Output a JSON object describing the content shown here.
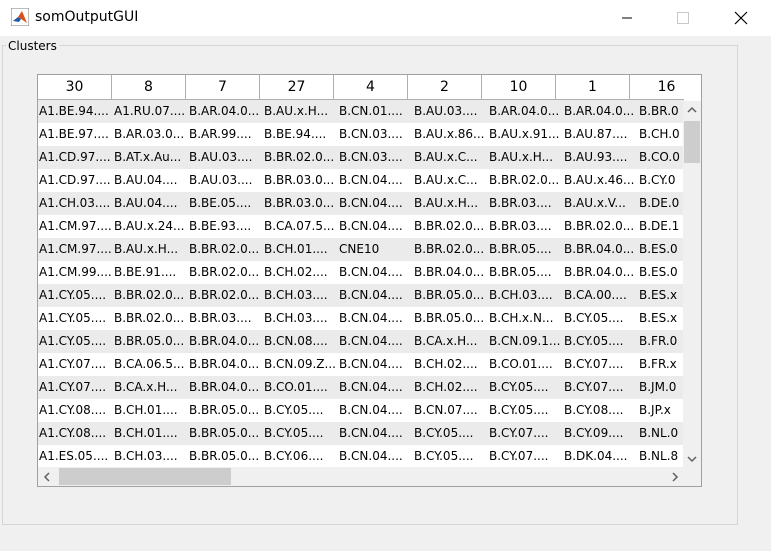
{
  "window": {
    "title": "somOutputGUI"
  },
  "panel": {
    "title": "Clusters"
  },
  "table": {
    "columns": [
      "30",
      "8",
      "7",
      "27",
      "4",
      "2",
      "10",
      "1",
      "16"
    ],
    "rows": [
      [
        "A1.BE.94....",
        "A1.RU.07....",
        "B.AR.04.0...",
        "B.AU.x.H...",
        "B.CN.01....",
        "B.AU.03....",
        "B.AR.04.0...",
        "B.AR.04.0...",
        "B.BR.0"
      ],
      [
        "A1.BE.97....",
        "B.AR.03.0...",
        "B.AR.99....",
        "B.BE.94....",
        "B.CN.03....",
        "B.AU.x.86...",
        "B.AU.x.91...",
        "B.AU.87....",
        "B.CH.0"
      ],
      [
        "A1.CD.97....",
        "B.AT.x.Au...",
        "B.AU.03....",
        "B.BR.02.0...",
        "B.CN.03....",
        "B.AU.x.C...",
        "B.AU.x.H...",
        "B.AU.93....",
        "B.CO.0"
      ],
      [
        "A1.CD.97....",
        "B.AU.04....",
        "B.AU.03....",
        "B.BR.03.0...",
        "B.CN.04....",
        "B.AU.x.C...",
        "B.BR.02.0...",
        "B.AU.x.46...",
        "B.CY.0"
      ],
      [
        "A1.CH.03....",
        "B.AU.04....",
        "B.BE.05....",
        "B.BR.03.0...",
        "B.CN.04....",
        "B.AU.x.H...",
        "B.BR.03....",
        "B.AU.x.V...",
        "B.DE.0"
      ],
      [
        "A1.CM.97....",
        "B.AU.x.24...",
        "B.BE.93....",
        "B.CA.07.5...",
        "B.CN.04....",
        "B.BR.02.0...",
        "B.BR.03....",
        "B.BR.02.0...",
        "B.DE.1"
      ],
      [
        "A1.CM.97....",
        "B.AU.x.H...",
        "B.BR.02.0...",
        "B.CH.01....",
        "CNE10",
        "B.BR.02.0...",
        "B.BR.05....",
        "B.BR.04.0...",
        "B.ES.0"
      ],
      [
        "A1.CM.99....",
        "B.BE.91....",
        "B.BR.02.0...",
        "B.CH.02....",
        "B.CN.04....",
        "B.BR.04.0...",
        "B.BR.05....",
        "B.BR.04.0...",
        "B.ES.0"
      ],
      [
        "A1.CY.05....",
        "B.BR.02.0...",
        "B.BR.02.0...",
        "B.CH.03....",
        "B.CN.04....",
        "B.BR.05.0...",
        "B.CH.03....",
        "B.CA.00....",
        "B.ES.x"
      ],
      [
        "A1.CY.05....",
        "B.BR.02.0...",
        "B.BR.03....",
        "B.CH.03....",
        "B.CN.04....",
        "B.BR.05.0...",
        "B.CH.x.N...",
        "B.CY.05....",
        "B.ES.x"
      ],
      [
        "A1.CY.05....",
        "B.BR.05.0...",
        "B.BR.04.0...",
        "B.CN.08....",
        "B.CN.04....",
        "B.CA.x.H...",
        "B.CN.09.1...",
        "B.CY.05....",
        "B.FR.0"
      ],
      [
        "A1.CY.07....",
        "B.CA.06.5...",
        "B.BR.04.0...",
        "B.CN.09.Z...",
        "B.CN.04....",
        "B.CH.02....",
        "B.CO.01....",
        "B.CY.07....",
        "B.FR.x"
      ],
      [
        "A1.CY.07....",
        "B.CA.x.H...",
        "B.BR.04.0...",
        "B.CO.01....",
        "B.CN.04....",
        "B.CH.02....",
        "B.CY.05....",
        "B.CY.07....",
        "B.JM.0"
      ],
      [
        "A1.CY.08....",
        "B.CH.01....",
        "B.BR.05.0...",
        "B.CY.05....",
        "B.CN.04....",
        "B.CN.07....",
        "B.CY.05....",
        "B.CY.08....",
        "B.JP.x"
      ],
      [
        "A1.CY.08....",
        "B.CH.01....",
        "B.BR.05.0...",
        "B.CY.05....",
        "B.CN.04....",
        "B.CY.05....",
        "B.CY.07....",
        "B.CY.09....",
        "B.NL.0"
      ],
      [
        "A1.ES.05....",
        "B.CH.03....",
        "B.BR.05.0...",
        "B.CY.06....",
        "B.CN.04....",
        "B.CY.05....",
        "B.CY.07....",
        "B.DK.04....",
        "B.NL.8"
      ]
    ]
  },
  "icons": {
    "app": "matlab-icon",
    "minimize": "minimize-icon",
    "maximize": "maximize-icon",
    "close": "close-icon"
  },
  "colors": {
    "row_alt": "#ebebeb",
    "row_white": "#ffffff",
    "client_bg": "#f0f0f0",
    "scroll_thumb": "#cdcdcd"
  }
}
